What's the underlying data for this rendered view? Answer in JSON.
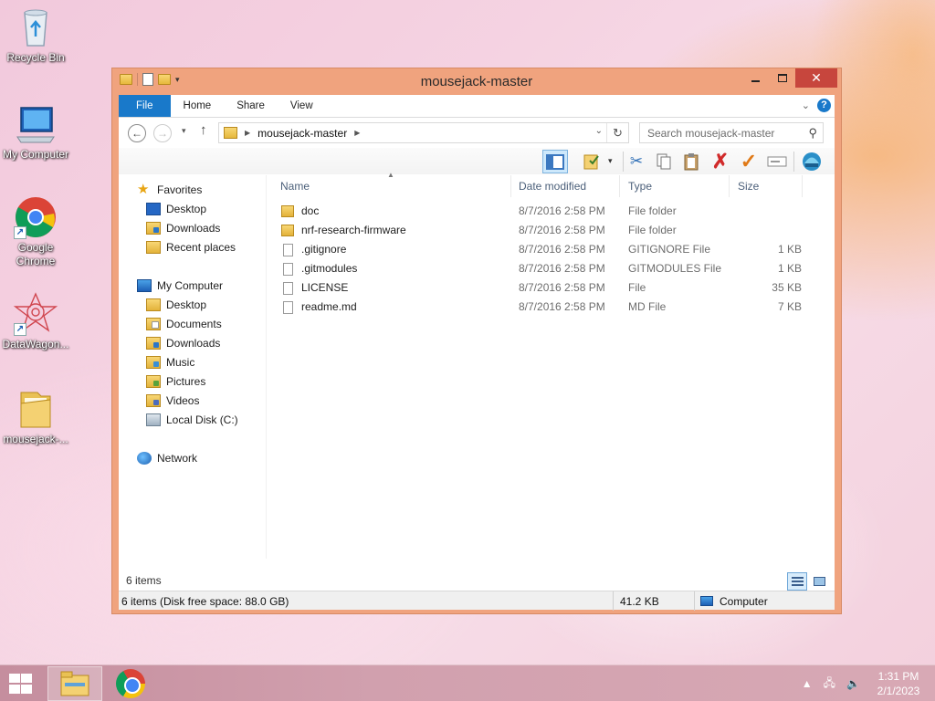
{
  "desktop": {
    "icons": [
      {
        "label": "Recycle Bin"
      },
      {
        "label": "My Computer"
      },
      {
        "label": "Google Chrome"
      },
      {
        "label": "DataWagon..."
      },
      {
        "label": "mousejack-..."
      }
    ]
  },
  "window": {
    "title": "mousejack-master",
    "ribbon_tabs": [
      "File",
      "Home",
      "Share",
      "View"
    ],
    "address": {
      "path_segment": "mousejack-master"
    },
    "search_placeholder": "Search mousejack-master",
    "nav_pane": {
      "favorites_label": "Favorites",
      "favorites": [
        "Desktop",
        "Downloads",
        "Recent places"
      ],
      "computer_label": "My Computer",
      "computer_items": [
        "Desktop",
        "Documents",
        "Downloads",
        "Music",
        "Pictures",
        "Videos",
        "Local Disk (C:)"
      ],
      "network_label": "Network"
    },
    "columns": {
      "name": "Name",
      "date": "Date modified",
      "type": "Type",
      "size": "Size"
    },
    "files": [
      {
        "name": "doc",
        "date": "8/7/2016 2:58 PM",
        "type": "File folder",
        "size": "",
        "kind": "folder"
      },
      {
        "name": "nrf-research-firmware",
        "date": "8/7/2016 2:58 PM",
        "type": "File folder",
        "size": "",
        "kind": "folder"
      },
      {
        "name": ".gitignore",
        "date": "8/7/2016 2:58 PM",
        "type": "GITIGNORE File",
        "size": "1 KB",
        "kind": "file"
      },
      {
        "name": ".gitmodules",
        "date": "8/7/2016 2:58 PM",
        "type": "GITMODULES File",
        "size": "1 KB",
        "kind": "file"
      },
      {
        "name": "LICENSE",
        "date": "8/7/2016 2:58 PM",
        "type": "File",
        "size": "35 KB",
        "kind": "file"
      },
      {
        "name": "readme.md",
        "date": "8/7/2016 2:58 PM",
        "type": "MD File",
        "size": "7 KB",
        "kind": "file"
      }
    ],
    "item_count": "6 items",
    "status": {
      "summary": "6 items (Disk free space: 88.0 GB)",
      "size": "41.2 KB",
      "location": "Computer"
    }
  },
  "taskbar": {
    "time": "1:31 PM",
    "date": "2/1/2023"
  },
  "colors": {
    "file_tab": "#1979ca",
    "window_frame": "#f0a37e",
    "close_button": "#c7463d"
  }
}
